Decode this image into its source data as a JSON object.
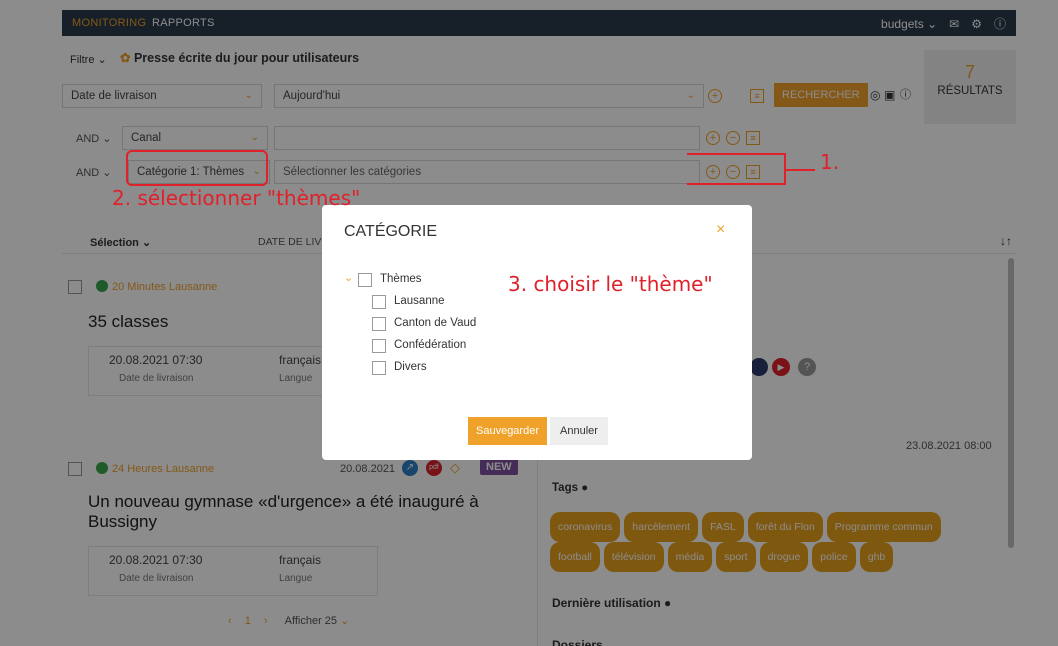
{
  "topbar": {
    "tabs": [
      "MONITORING",
      "RAPPORTS"
    ],
    "user": "budgets"
  },
  "filter": {
    "filtre_label": "Filtre",
    "preset_title": "Presse écrite du jour pour utilisateurs",
    "row1": {
      "field": "Date de livraison",
      "value": "Aujourd'hui"
    },
    "row2": {
      "op": "AND",
      "field": "Canal",
      "value": ""
    },
    "row3": {
      "op": "AND",
      "field": "Catégorie 1: Thèmes",
      "placeholder": "Sélectionner les catégories"
    },
    "search_button": "RECHERCHER",
    "results_count": "7",
    "results_label": "RÉSULTATS"
  },
  "list": {
    "header": {
      "selection": "Sélection",
      "date_col": "DATE DE LIV"
    },
    "items": [
      {
        "source": "20 Minutes Lausanne",
        "title": "35 classes",
        "date": "20.08.2021 07:30",
        "date_label": "Date de livraison",
        "lang": "français",
        "lang_label": "Langue"
      },
      {
        "source": "24 Heures Lausanne",
        "pub_date": "20.08.2021",
        "badge": "NEW",
        "title": "Un nouveau gymnase «d'urgence» a été inauguré à Bussigny",
        "date": "20.08.2021 07:30",
        "date_label": "Date de livraison",
        "lang": "français",
        "lang_label": "Langue"
      }
    ],
    "pagination": {
      "page": "1",
      "show": "Afficher 25"
    }
  },
  "detail": {
    "timestamp": "23.08.2021 08:00",
    "tags_label": "Tags",
    "tags": [
      "coronavirus",
      "harcèlement",
      "FASL",
      "forêt du Flon",
      "Programme commun",
      "football",
      "télévision",
      "média",
      "sport",
      "drogue",
      "police",
      "ghb"
    ],
    "last_use_label": "Dernière utilisation",
    "dossiers_label": "Dossiers"
  },
  "modal": {
    "title": "CATÉGORIE",
    "root": "Thèmes",
    "children": [
      "Lausanne",
      "Canton de Vaud",
      "Confédération",
      "Divers"
    ],
    "save": "Sauvegarder",
    "cancel": "Annuler"
  },
  "annotations": {
    "a1": "1.",
    "a2": "2. sélectionner \"thèmes\"",
    "a3": "3. choisir le \"thème\""
  },
  "colors": {
    "accent": "#f0a12a",
    "annotation": "#e0212a",
    "topbar": "#2a3a4c"
  }
}
